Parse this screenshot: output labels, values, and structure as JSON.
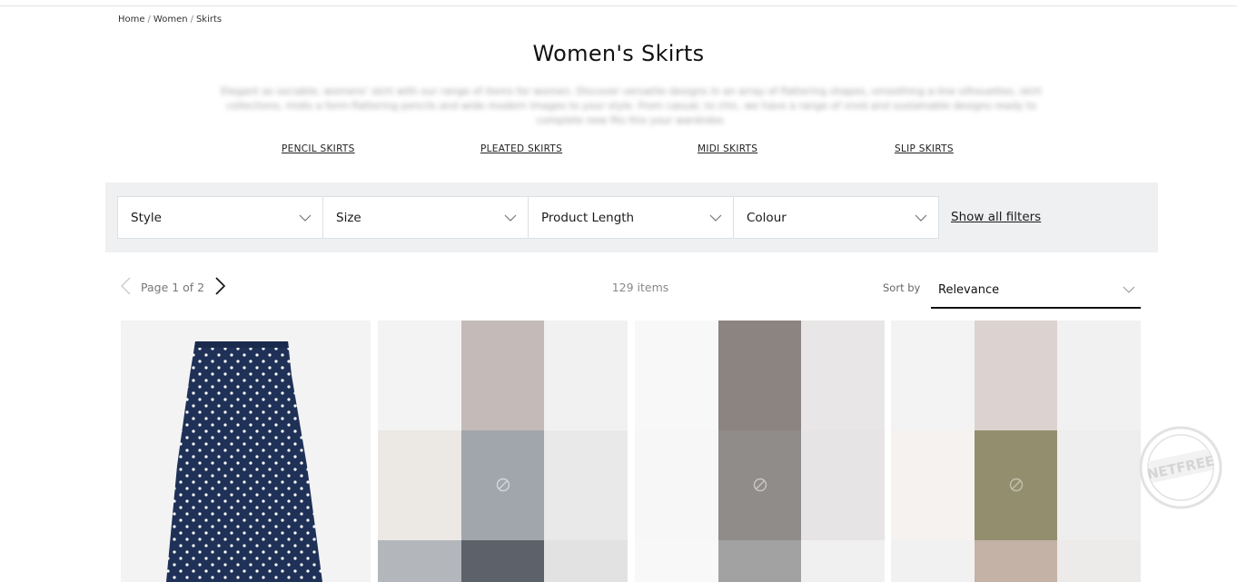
{
  "breadcrumb": {
    "items": [
      "Home",
      "Women",
      "Skirts"
    ],
    "separator": "/"
  },
  "page": {
    "title": "Women's Skirts",
    "intro": "Elegant as sociable, womens' skirt with our range of items for women. Discover versatile designs in an array of flattering shapes, smoothing a-line silhouettes, skirt collections, midis a form-flattering pencils and wide modern images to your style. From casual, to chic, we have a range of vivid and sustainable designs ready to complete new fits this your wardrobe."
  },
  "category_links": [
    "PENCIL SKIRTS",
    "PLEATED SKIRTS",
    "MIDI SKIRTS",
    "SLIP SKIRTS"
  ],
  "filters": {
    "dropdowns": [
      {
        "label": "Style"
      },
      {
        "label": "Size"
      },
      {
        "label": "Product Length"
      },
      {
        "label": "Colour"
      }
    ],
    "show_all_label": "Show all filters"
  },
  "listing": {
    "page_text": "Page 1 of 2",
    "items_count": "129 items",
    "sort_label": "Sort by",
    "sort_value": "Relevance"
  },
  "colors": {
    "filter_bar_bg": "#eef0f2",
    "navy_skirt": "#1f3157",
    "polka_dot": "#ffffff"
  },
  "products": [
    {
      "type": "image",
      "icon": "polka-dot-skirt"
    },
    {
      "type": "placeholder",
      "icon": "image-unavailable-icon",
      "palette": [
        "#c4bbb8",
        "#a1a6ad",
        "#5d626a",
        "#ece8e4",
        "#e9e9e9",
        "#b3b6bb"
      ]
    },
    {
      "type": "placeholder",
      "icon": "image-unavailable-icon",
      "palette": [
        "#8c8481",
        "#8f8c89",
        "#a3a2a3",
        "#f7f7f7",
        "#e8e6e6",
        "#f0f0f0"
      ]
    },
    {
      "type": "placeholder",
      "icon": "image-unavailable-icon",
      "palette": [
        "#dcd3d0",
        "#938f6e",
        "#c5b2a6",
        "#f5f2ef",
        "#efeeee",
        "#ecebea"
      ]
    }
  ],
  "watermark": {
    "text": "NETFREE",
    "icon": "netfree-seal"
  }
}
